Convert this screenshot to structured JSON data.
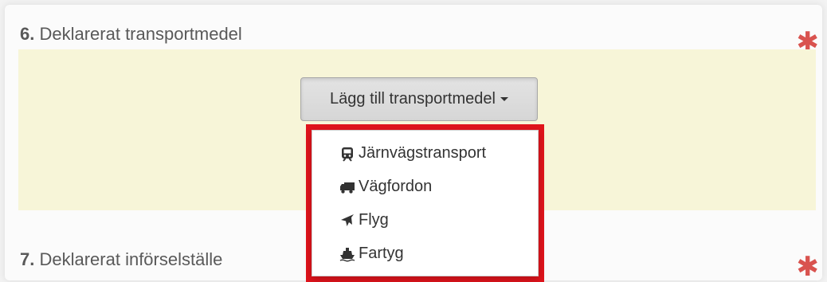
{
  "section6": {
    "number": "6.",
    "title": " Deklarerat transportmedel",
    "required": "✱"
  },
  "add_button": {
    "label": "Lägg till transportmedel"
  },
  "dropdown": {
    "items": [
      {
        "label": "Järnvägstransport",
        "icon": "train-icon"
      },
      {
        "label": "Vägfordon",
        "icon": "truck-icon"
      },
      {
        "label": "Flyg",
        "icon": "plane-icon"
      },
      {
        "label": "Fartyg",
        "icon": "ship-icon"
      }
    ],
    "highlight_color": "#e0141c"
  },
  "section7": {
    "number": "7.",
    "title": " Deklarerat införselställe",
    "required": "✱"
  },
  "colors": {
    "required": "#d9534f",
    "area_background": "#f7f5d8"
  }
}
